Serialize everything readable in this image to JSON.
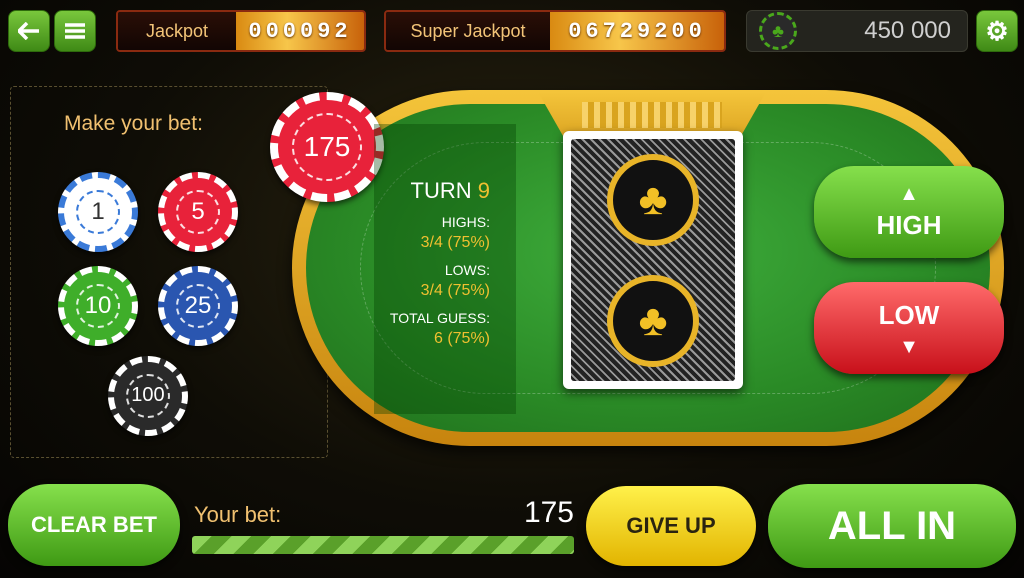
{
  "top_bar": {
    "jackpot_label": "Jackpot",
    "jackpot_value": "000092",
    "super_jackpot_label": "Super Jackpot",
    "super_jackpot_value": "06729200",
    "balance": "450 000"
  },
  "bet_panel": {
    "prompt": "Make your bet:",
    "chips": [
      {
        "value": "1",
        "color": "#ffffff",
        "accent": "#3a7ad8"
      },
      {
        "value": "5",
        "color": "#e8223a"
      },
      {
        "value": "10",
        "color": "#3fae2a"
      },
      {
        "value": "25",
        "color": "#2a56b0"
      },
      {
        "value": "100",
        "color": "#2a2a2a"
      }
    ],
    "placed_chip": "175"
  },
  "stats": {
    "turn_label": "TURN",
    "turn_value": "9",
    "highs_label": "HIGHS:",
    "highs_value": "3/4 (75%)",
    "lows_label": "LOWS:",
    "lows_value": "3/4 (75%)",
    "total_label": "TOTAL GUESS:",
    "total_value": "6 (75%)"
  },
  "buttons": {
    "high": "HIGH",
    "low": "LOW",
    "clear_bet": "CLEAR BET",
    "give_up": "GIVE UP",
    "all_in": "ALL IN"
  },
  "bottom": {
    "your_bet_label": "Your bet:",
    "your_bet_value": "175",
    "bet_fill_fraction": 1.0
  },
  "colors": {
    "accent_gold": "#f0c030",
    "table_green": "#2a8a26",
    "button_green": "#4aa81c",
    "button_red": "#d8202a",
    "button_yellow": "#f2d000"
  }
}
